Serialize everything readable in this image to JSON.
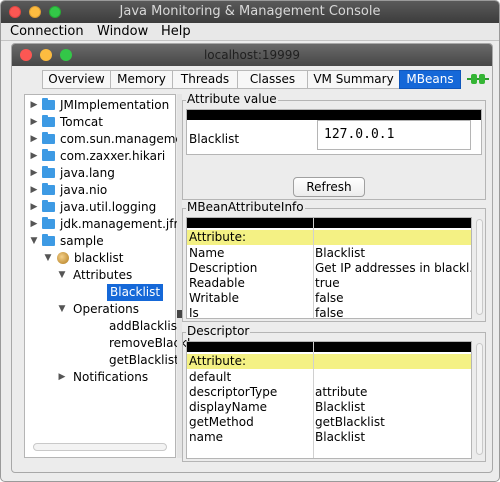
{
  "window": {
    "title": "Java Monitoring & Management Console"
  },
  "menu": [
    "Connection",
    "Window",
    "Help"
  ],
  "inner_window": {
    "title": "localhost:19999"
  },
  "tabs": [
    "Overview",
    "Memory",
    "Threads",
    "Classes",
    "VM Summary",
    "MBeans"
  ],
  "active_tab": "MBeans",
  "tree": {
    "folders": [
      "JMImplementation",
      "Tomcat",
      "com.sun.manageme",
      "com.zaxxer.hikari",
      "java.lang",
      "java.nio",
      "java.util.logging",
      "jdk.management.jfr",
      "sample"
    ],
    "bean": "blacklist",
    "attributes_label": "Attributes",
    "selected_attribute": "Blacklist",
    "operations_label": "Operations",
    "operations": [
      "addBlacklist",
      "removeBlackl",
      "getBlacklist"
    ],
    "notifications_label": "Notifications"
  },
  "attribute_value": {
    "title": "Attribute value",
    "name": "Blacklist",
    "value": "127.0.0.1",
    "refresh_label": "Refresh"
  },
  "mbean_attribute_info": {
    "title": "MBeanAttributeInfo",
    "header": "Attribute:",
    "rows": [
      {
        "key": "Name",
        "value": "Blacklist"
      },
      {
        "key": "Description",
        "value": "Get IP addresses in blackl..."
      },
      {
        "key": "Readable",
        "value": "true"
      },
      {
        "key": "Writable",
        "value": "false"
      },
      {
        "key": "Is",
        "value": "false"
      }
    ]
  },
  "descriptor": {
    "title": "Descriptor",
    "header": "Attribute:",
    "rows": [
      {
        "key": "default",
        "value": ""
      },
      {
        "key": "descriptorType",
        "value": "attribute"
      },
      {
        "key": "displayName",
        "value": "Blacklist"
      },
      {
        "key": "getMethod",
        "value": "getBlacklist"
      },
      {
        "key": "name",
        "value": "Blacklist"
      }
    ]
  },
  "colors": {
    "accent": "#1568d8",
    "highlight": "#f4f184"
  }
}
